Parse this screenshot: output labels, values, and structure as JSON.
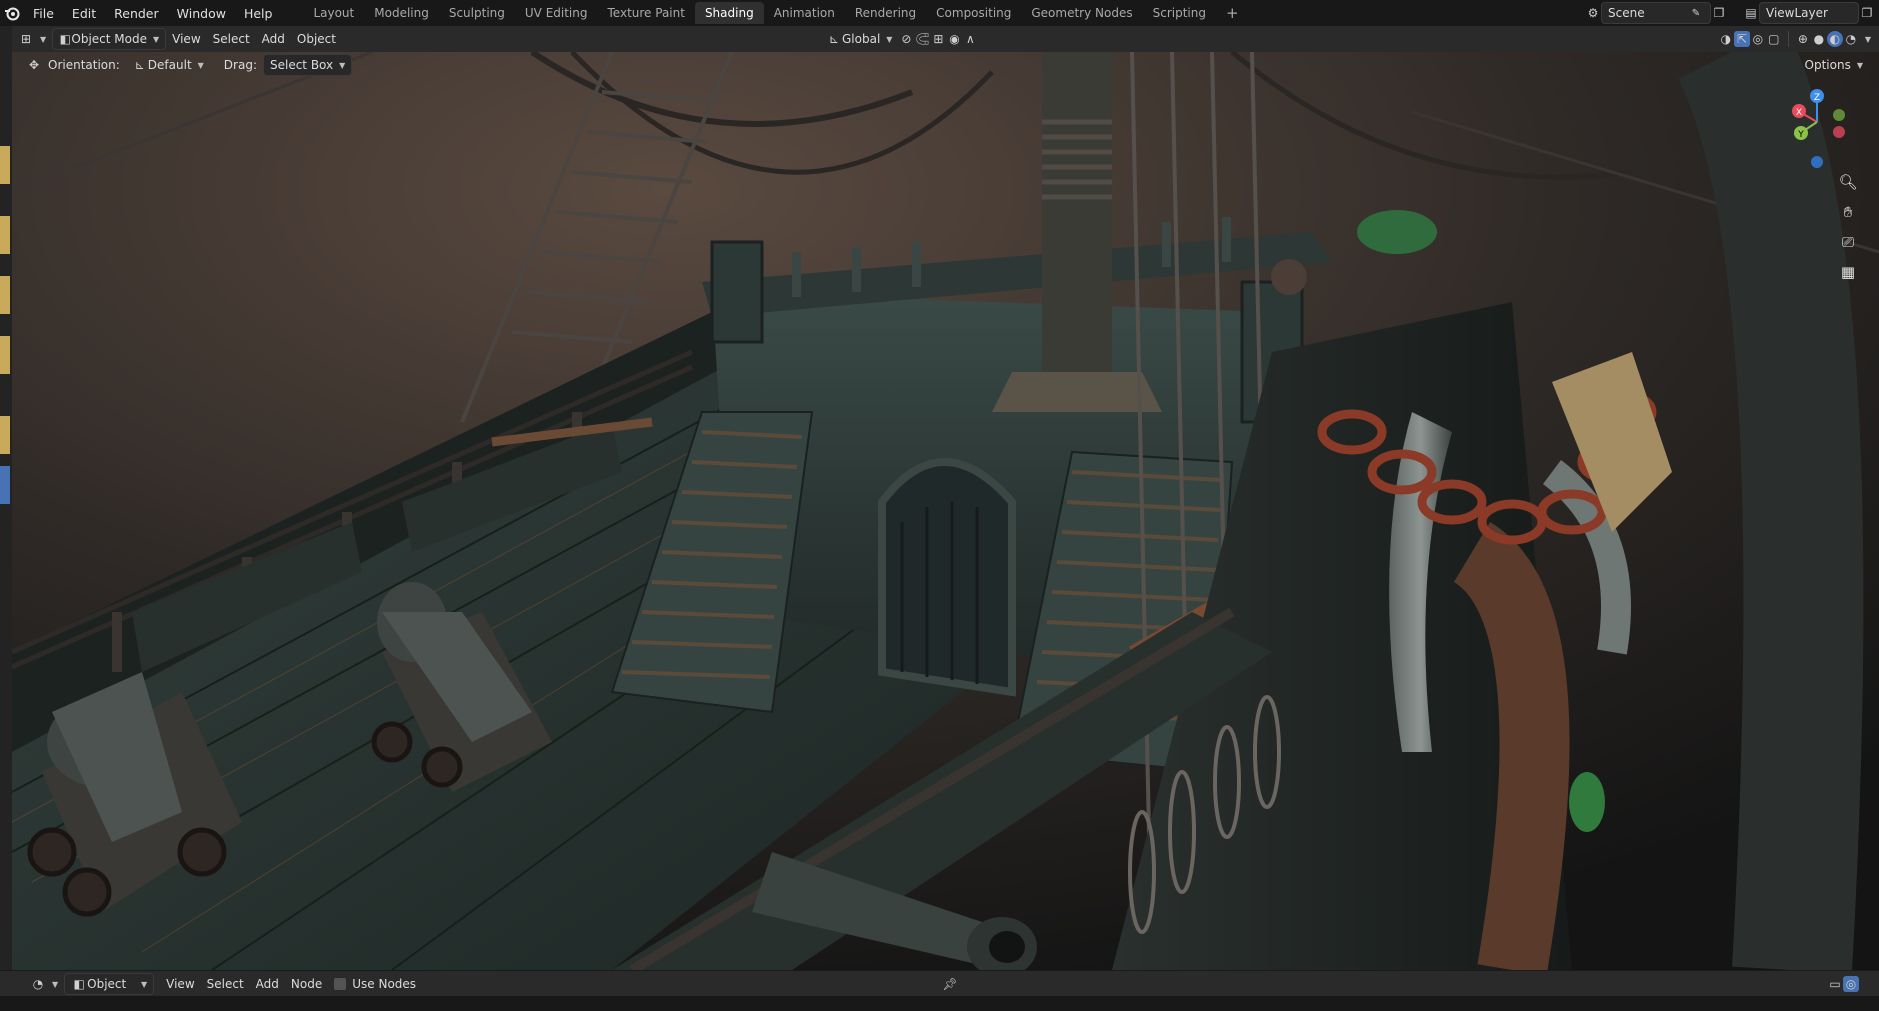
{
  "topbar": {
    "menus": [
      "File",
      "Edit",
      "Render",
      "Window",
      "Help"
    ],
    "workspaces": [
      "Layout",
      "Modeling",
      "Sculpting",
      "UV Editing",
      "Texture Paint",
      "Shading",
      "Animation",
      "Rendering",
      "Compositing",
      "Geometry Nodes",
      "Scripting"
    ],
    "active_workspace": "Shading",
    "add_workspace": "+",
    "scene": "Scene",
    "view_layer": "ViewLayer"
  },
  "viewport_header": {
    "mode": "Object Mode",
    "menus": [
      "View",
      "Select",
      "Add",
      "Object"
    ],
    "transform_orientation": "Global"
  },
  "tool_header": {
    "orientation_label": "Orientation:",
    "orientation_value": "Default",
    "drag_label": "Drag:",
    "drag_value": "Select Box",
    "options": "Options"
  },
  "gizmo": {
    "x": "X",
    "y": "Y",
    "z": "Z"
  },
  "node_editor_header": {
    "object_type": "Object",
    "menus": [
      "View",
      "Select",
      "Add",
      "Node"
    ],
    "use_nodes": "Use Nodes"
  },
  "colors": {
    "accent": "#4772b3",
    "axis_x": "#e94b5c",
    "axis_y": "#8bc34a",
    "axis_z": "#3f8ee9"
  }
}
